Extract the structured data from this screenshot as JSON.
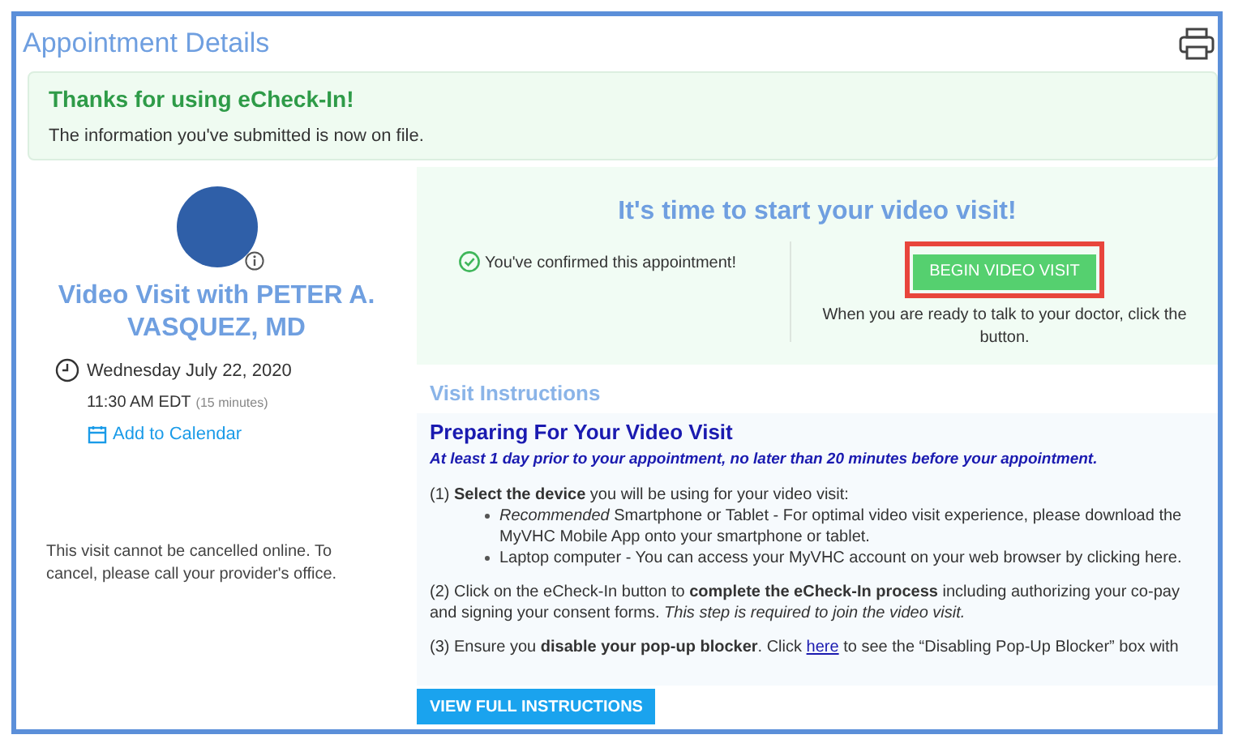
{
  "header": {
    "title": "Appointment Details"
  },
  "banner": {
    "title": "Thanks for using eCheck-In!",
    "message": "The information you've submitted is now on file."
  },
  "appointment": {
    "heading": "Video Visit with PETER A. VASQUEZ, MD",
    "date": "Wednesday July 22, 2020",
    "time": "11:30 AM EDT",
    "duration": "(15 minutes)",
    "add_to_calendar": "Add to Calendar",
    "cancel_note": "This visit cannot be cancelled online. To cancel, please call your provider's office."
  },
  "video": {
    "heading": "It's time to start your video visit!",
    "confirmed": "You've confirmed this appointment!",
    "button": "BEGIN VIDEO VISIT",
    "hint": "When you are ready to talk to your doctor, click the button."
  },
  "instructions": {
    "heading": "Visit Instructions",
    "title": "Preparing For Your Video Visit",
    "subtitle": "At least 1 day prior to your appointment, no later than 20 minutes before your appointment.",
    "steps": [
      {
        "text": "(1) **Select the device** you will be using for your video visit:",
        "bullets": [
          "*Recommended* Smartphone or Tablet - For optimal video visit experience, please download the MyVHC Mobile App onto your smartphone or tablet.",
          "Laptop computer - You can access your MyVHC account on your web browser by clicking here."
        ]
      },
      {
        "text": "(2) Click on the eCheck-In button to **complete the eCheck-In process** including authorizing your co-pay and signing your consent forms. *This step is required to join the video visit.*"
      },
      {
        "text": "(3) Ensure you **disable your pop-up blocker**. Click",
        "link": "here",
        "after": "to see the “Disabling Pop-Up Blocker” box with"
      }
    ],
    "button": "VIEW FULL INSTRUCTIONS"
  }
}
